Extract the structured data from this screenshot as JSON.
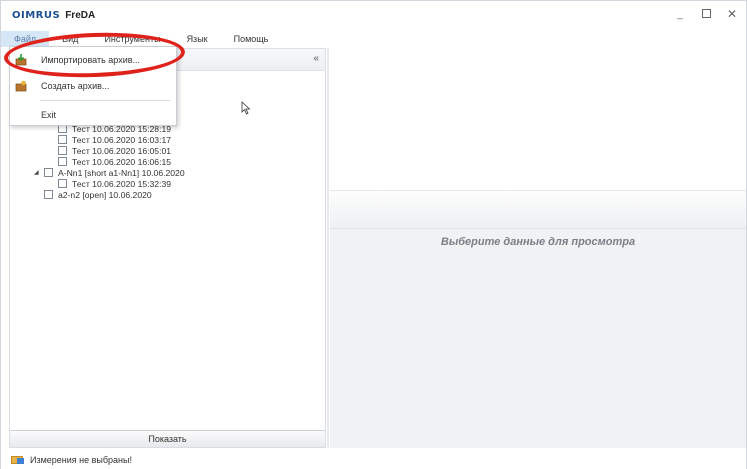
{
  "app": {
    "logo": "OIMRUS",
    "name": "FreDA"
  },
  "window_controls": {
    "minimize": "_",
    "close": "✕"
  },
  "menu": [
    {
      "label": "Файл",
      "active": true
    },
    {
      "label": "Вид",
      "active": false
    },
    {
      "label": "Инструменты",
      "active": false
    },
    {
      "label": "Язык",
      "active": false
    },
    {
      "label": "Помощь",
      "active": false
    }
  ],
  "file_menu": {
    "items": [
      {
        "label": "Импортировать архив...",
        "icon": "import-archive-icon"
      },
      {
        "label": "Создать архив...",
        "icon": "create-archive-icon"
      },
      {
        "label": "Exit",
        "icon": ""
      }
    ]
  },
  "left_panel": {
    "collapse_glyph": "«",
    "tree": [
      {
        "level": 2,
        "label": "Тест 10.06.2020 15:28:19",
        "expander": ""
      },
      {
        "level": 2,
        "label": "Тест 10.06.2020 16:03:17",
        "expander": ""
      },
      {
        "level": 2,
        "label": "Тест 10.06.2020 16:05:01",
        "expander": ""
      },
      {
        "level": 2,
        "label": "Тест 10.06.2020 16:06:15",
        "expander": ""
      },
      {
        "level": 1,
        "label": "A-Nn1 [short a1-Nn1] 10.06.2020",
        "expander": "◢"
      },
      {
        "level": 2,
        "label": "Тест 10.06.2020 15:32:39",
        "expander": ""
      },
      {
        "level": 1,
        "label": "a2-n2 [open] 10.06.2020",
        "expander": ""
      }
    ],
    "show_button": "Показать"
  },
  "right_panel": {
    "empty_message": "Выберите данные для просмотра"
  },
  "status": {
    "text": "Измерения не выбраны!"
  },
  "colors": {
    "annotation": "#e0221c",
    "menu_active_bg": "#d5e6f7",
    "logo": "#1d4f91"
  }
}
